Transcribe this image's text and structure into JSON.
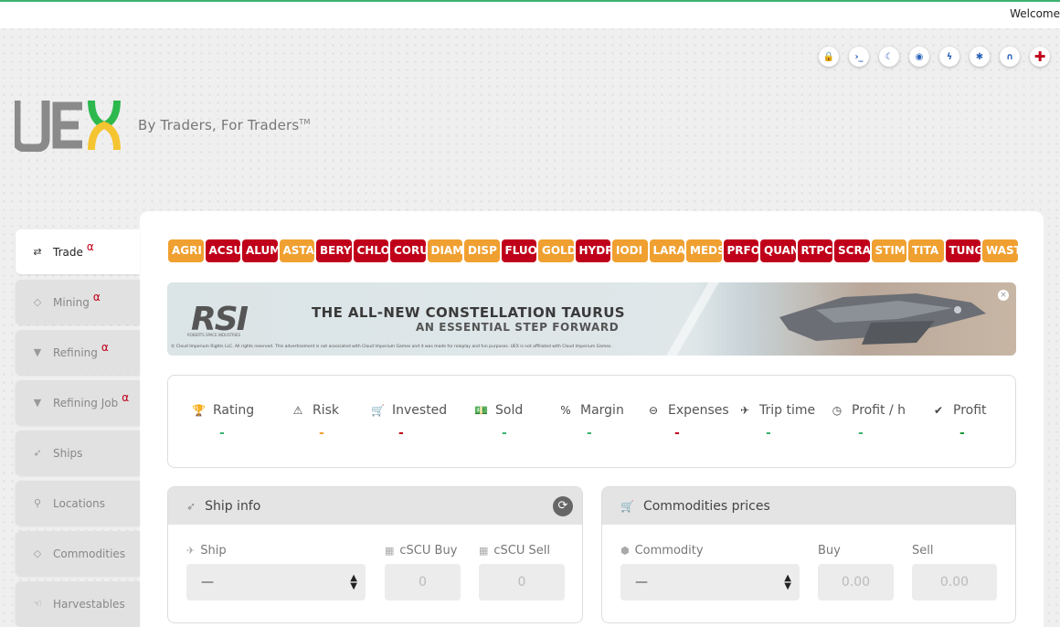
{
  "topbar": {
    "welcome": "Welcome"
  },
  "toolbar": [
    {
      "icon": "lock-icon",
      "glyph": "🔒"
    },
    {
      "icon": "terminal-icon",
      "glyph": "›_"
    },
    {
      "icon": "moon-icon",
      "glyph": "☾"
    },
    {
      "icon": "target-icon",
      "glyph": "◉"
    },
    {
      "icon": "bolt-icon",
      "glyph": "ϟ"
    },
    {
      "icon": "bug-icon",
      "glyph": "✱"
    },
    {
      "icon": "headset-icon",
      "glyph": "∩"
    },
    {
      "icon": "plus-icon",
      "glyph": "✚"
    }
  ],
  "brand": {
    "logo_text": "UEX",
    "tagline": "By Traders, For Traders",
    "tm": "TM"
  },
  "sidebar": {
    "items": [
      {
        "label": "Trade",
        "icon": "exchange-icon",
        "glyph": "⇄",
        "alpha": "α",
        "active": true
      },
      {
        "label": "Mining",
        "icon": "diamond-icon",
        "glyph": "◇",
        "alpha": "α"
      },
      {
        "label": "Refining",
        "icon": "filter-icon",
        "glyph": "▼",
        "alpha": "α"
      },
      {
        "label": "Refining Job",
        "icon": "filter-icon",
        "glyph": "▼",
        "alpha": "α"
      },
      {
        "label": "Ships",
        "icon": "rocket-icon",
        "glyph": "➶",
        "alpha": ""
      },
      {
        "label": "Locations",
        "icon": "map-pin-icon",
        "glyph": "⚲",
        "alpha": ""
      },
      {
        "label": "Commodities",
        "icon": "diamond-icon",
        "glyph": "◇",
        "alpha": ""
      },
      {
        "label": "Harvestables",
        "icon": "hand-icon",
        "glyph": "☜",
        "alpha": ""
      }
    ]
  },
  "chips": [
    {
      "label": "AGRI",
      "color": "#f0a030"
    },
    {
      "label": "ACSU",
      "color": "#c0001a"
    },
    {
      "label": "ALUM",
      "color": "#c0001a"
    },
    {
      "label": "ASTA",
      "color": "#f0a030"
    },
    {
      "label": "BERY",
      "color": "#c0001a"
    },
    {
      "label": "CHLO",
      "color": "#c0001a"
    },
    {
      "label": "CORU",
      "color": "#c0001a"
    },
    {
      "label": "DIAM",
      "color": "#f0a030"
    },
    {
      "label": "DISP",
      "color": "#f0a030"
    },
    {
      "label": "FLUO",
      "color": "#c0001a"
    },
    {
      "label": "GOLD",
      "color": "#f0a030"
    },
    {
      "label": "HYDR",
      "color": "#c0001a"
    },
    {
      "label": "IODI",
      "color": "#f0a030"
    },
    {
      "label": "LARA",
      "color": "#f0a030"
    },
    {
      "label": "MEDS",
      "color": "#f0a030"
    },
    {
      "label": "PRFO",
      "color": "#c0001a"
    },
    {
      "label": "QUAN",
      "color": "#c0001a"
    },
    {
      "label": "RTPC",
      "color": "#c0001a"
    },
    {
      "label": "SCRA",
      "color": "#c0001a"
    },
    {
      "label": "STIM",
      "color": "#f0a030"
    },
    {
      "label": "TITA",
      "color": "#f0a030"
    },
    {
      "label": "TUNG",
      "color": "#c0001a"
    },
    {
      "label": "WAST",
      "color": "#f0a030"
    }
  ],
  "banner": {
    "brand": "RSI",
    "brand_sub": "ROBERTS SPACE INDUSTRIES",
    "headline": "THE ALL-NEW CONSTELLATION TAURUS",
    "subheadline": "AN ESSENTIAL STEP FORWARD",
    "disclaimer": "© Cloud Imperium Rights LLC. All rights reserved. This advertisement is not associated with Cloud Imperium Games and it was made for roleplay and fun purposes. UEX is not affiliated with Cloud Imperium Games.",
    "close": "×"
  },
  "stats": [
    {
      "label": "Rating",
      "icon": "trophy-icon",
      "glyph": "🏆",
      "value": "-",
      "color": "#3cb371"
    },
    {
      "label": "Risk",
      "icon": "warning-icon",
      "glyph": "⚠",
      "value": "-",
      "color": "#f0a030"
    },
    {
      "label": "Invested",
      "icon": "cart-icon",
      "glyph": "🛒",
      "value": "-",
      "color": "#c0001a"
    },
    {
      "label": "Sold",
      "icon": "money-icon",
      "glyph": "💵",
      "value": "-",
      "color": "#3cb371"
    },
    {
      "label": "Margin",
      "icon": "percent-icon",
      "glyph": "%",
      "value": "-",
      "color": "#3cb371"
    },
    {
      "label": "Expenses",
      "icon": "minus-circle-icon",
      "glyph": "⊖",
      "value": "-",
      "color": "#c0001a"
    },
    {
      "label": "Trip time",
      "icon": "plane-icon",
      "glyph": "✈",
      "value": "-",
      "color": "#3cb371"
    },
    {
      "label": "Profit / h",
      "icon": "clock-icon",
      "glyph": "◷",
      "value": "-",
      "color": "#3cb371"
    },
    {
      "label": "Profit",
      "icon": "check-circle-icon",
      "glyph": "✔",
      "value": "-",
      "color": "#1a9a3a"
    }
  ],
  "ship_info": {
    "title": "Ship info",
    "ship_label": "Ship",
    "ship_value": "—",
    "buy_label": "cSCU Buy",
    "buy_value": "0",
    "sell_label": "cSCU Sell",
    "sell_value": "0",
    "refresh": "⟳"
  },
  "commodities_prices": {
    "title": "Commodities prices",
    "commodity_label": "Commodity",
    "commodity_value": "—",
    "buy_label": "Buy",
    "buy_value": "0.00",
    "sell_label": "Sell",
    "sell_value": "0.00"
  }
}
